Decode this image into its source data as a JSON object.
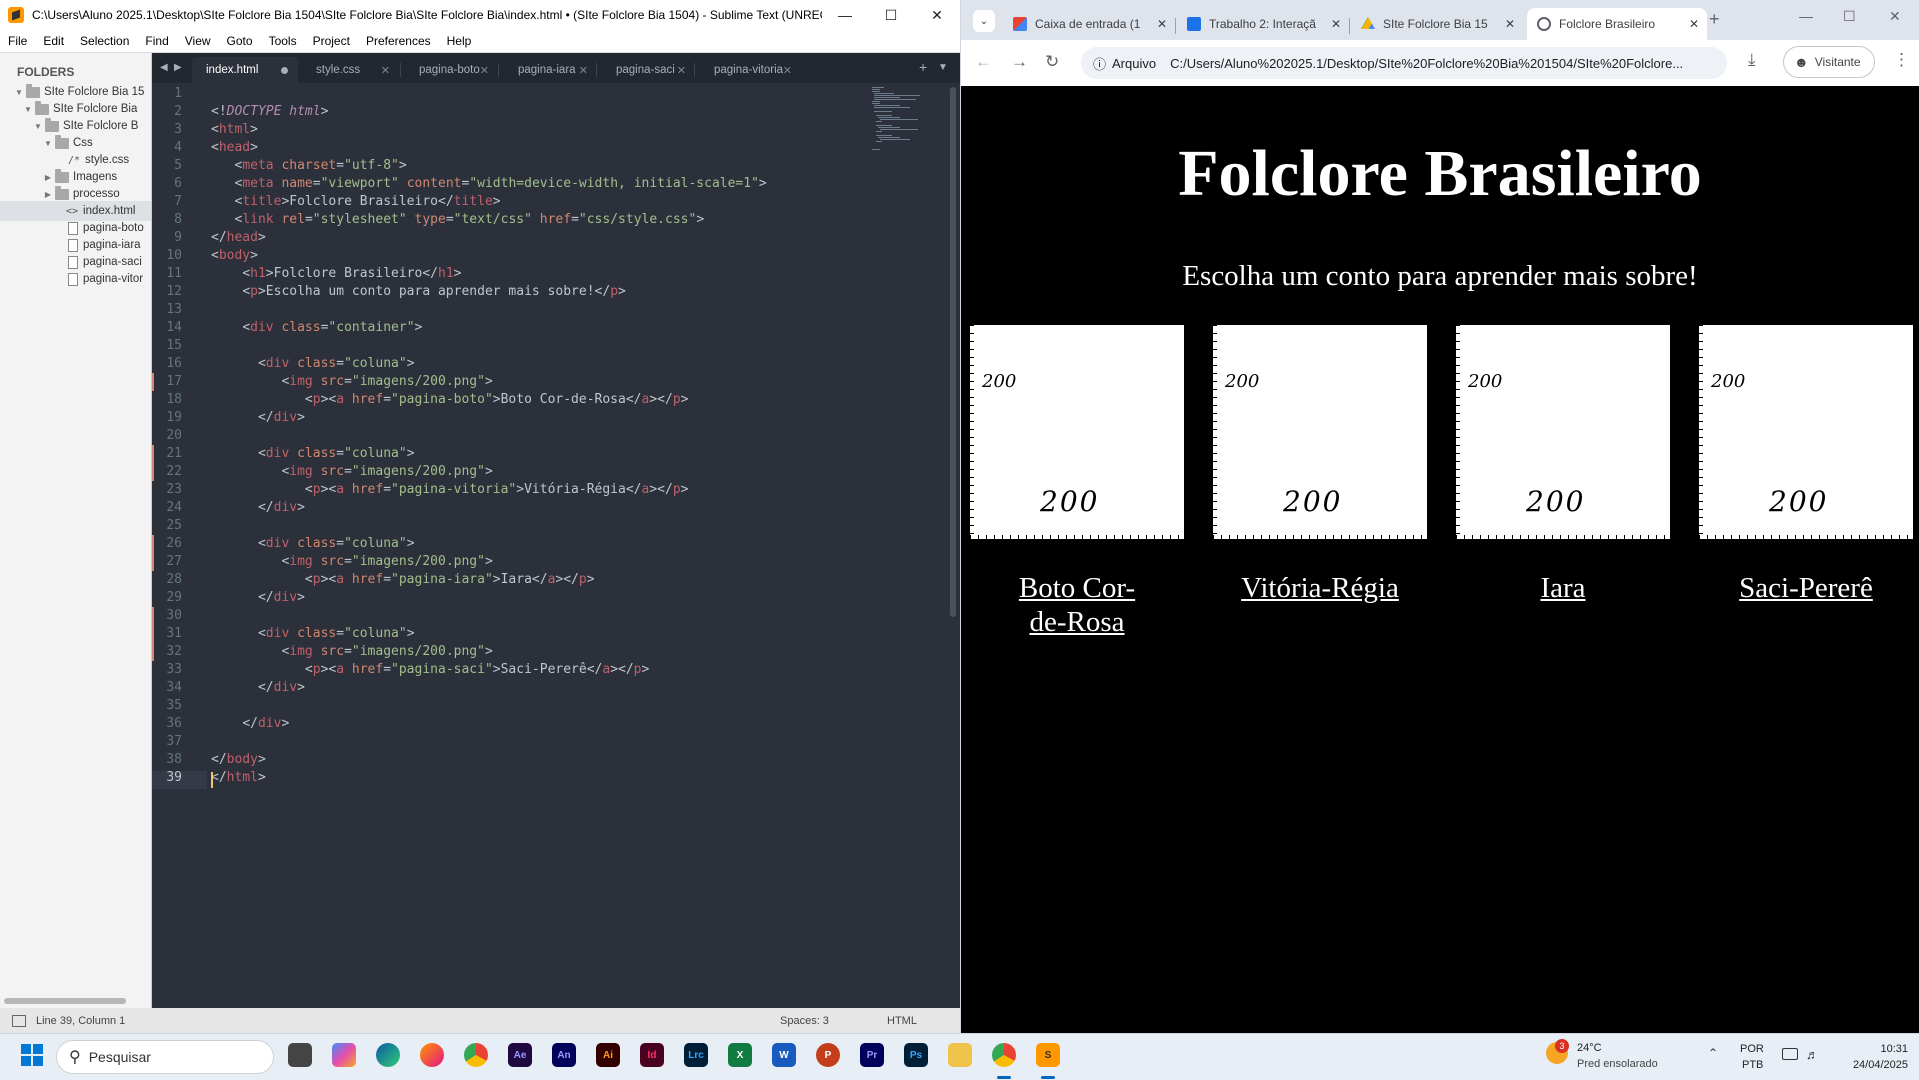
{
  "sublime": {
    "title": "C:\\Users\\Aluno 2025.1\\Desktop\\SIte Folclore Bia 1504\\SIte Folclore Bia\\SIte Folclore Bia\\index.html • (SIte Folclore Bia 1504) - Sublime Text (UNREGI...",
    "menu": [
      "File",
      "Edit",
      "Selection",
      "Find",
      "View",
      "Goto",
      "Tools",
      "Project",
      "Preferences",
      "Help"
    ],
    "sidebar": {
      "header": "FOLDERS",
      "items": [
        {
          "label": "SIte Folclore Bia 15",
          "type": "folder",
          "depth": 0,
          "open": true
        },
        {
          "label": "SIte Folclore Bia",
          "type": "folder",
          "depth": 1,
          "open": true
        },
        {
          "label": "SIte Folclore B",
          "type": "folder",
          "depth": 2,
          "open": true
        },
        {
          "label": "Css",
          "type": "folder",
          "depth": 3,
          "open": true
        },
        {
          "label": "style.css",
          "type": "css",
          "depth": 4
        },
        {
          "label": "Imagens",
          "type": "folder",
          "depth": 3,
          "open": false
        },
        {
          "label": "processo",
          "type": "folder",
          "depth": 3,
          "open": false
        },
        {
          "label": "index.html",
          "type": "html",
          "depth": 3,
          "selected": true
        },
        {
          "label": "pagina-boto",
          "type": "file",
          "depth": 3
        },
        {
          "label": "pagina-iara",
          "type": "file",
          "depth": 3
        },
        {
          "label": "pagina-saci",
          "type": "file",
          "depth": 3
        },
        {
          "label": "pagina-vitor",
          "type": "file",
          "depth": 3
        }
      ]
    },
    "tabs": [
      "index.html",
      "style.css",
      "pagina-boto",
      "pagina-iara",
      "pagina-saci",
      "pagina-vitoria"
    ],
    "line_numbers": [
      "1",
      "2",
      "3",
      "4",
      "5",
      "6",
      "7",
      "8",
      "9",
      "10",
      "11",
      "12",
      "13",
      "14",
      "15",
      "16",
      "17",
      "18",
      "19",
      "20",
      "21",
      "22",
      "23",
      "24",
      "25",
      "26",
      "27",
      "28",
      "29",
      "30",
      "31",
      "32",
      "33",
      "34",
      "35",
      "36",
      "37",
      "38",
      "39"
    ],
    "status": {
      "position": "Line 39, Column 1",
      "indent": "Spaces: 3",
      "syntax": "HTML"
    },
    "colors": {
      "background": "#2b303b",
      "tag": "#bf616a",
      "attr": "#d08770",
      "string": "#a3be8c",
      "text": "#c0c5ce"
    }
  },
  "chrome": {
    "tabs": [
      {
        "label": "Caixa de entrada (1",
        "icon": "gmail-icon"
      },
      {
        "label": "Trabalho 2: Interaçã",
        "icon": "classroom-icon"
      },
      {
        "label": "SIte Folclore Bia 15",
        "icon": "drive-icon"
      },
      {
        "label": "Folclore Brasileiro",
        "icon": "globe-icon"
      }
    ],
    "address": {
      "chip": "Arquivo",
      "url": "C:/Users/Aluno%202025.1/Desktop/SIte%20Folclore%20Bia%201504/SIte%20Folclore..."
    },
    "profile": "Visitante"
  },
  "page": {
    "h1": "Folclore Brasileiro",
    "intro": "Escolha um conto para aprender mais sobre!",
    "cards": [
      {
        "small": "200",
        "big": "200",
        "link": "Boto Cor-de-Rosa"
      },
      {
        "small": "200",
        "big": "200",
        "link": "Vitória-Régia"
      },
      {
        "small": "200",
        "big": "200",
        "link": "Iara"
      },
      {
        "small": "200",
        "big": "200",
        "link": "Saci-Pererê"
      }
    ]
  },
  "taskbar": {
    "search": "Pesquisar",
    "weather": {
      "temp": "24°C",
      "desc": "Pred ensolarado",
      "badge": "3"
    },
    "lang": {
      "top": "POR",
      "bottom": "PTB"
    },
    "clock": {
      "time": "10:31",
      "date": "24/04/2025"
    }
  }
}
